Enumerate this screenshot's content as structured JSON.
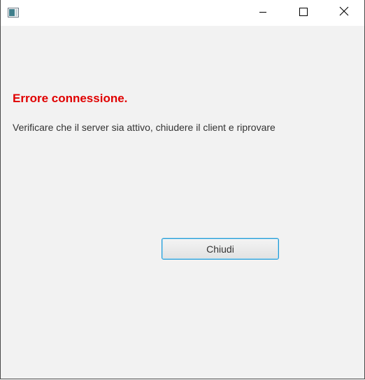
{
  "window": {
    "title_icon": "java-app-icon",
    "controls": {
      "minimize_icon": "minimize-icon",
      "maximize_icon": "maximize-icon",
      "close_icon": "close-icon"
    }
  },
  "dialog": {
    "title": "Errore connessione.",
    "message": "Verificare che il server sia attivo, chiudere il client e riprovare",
    "button_label": "Chiudi"
  },
  "colors": {
    "error_title": "#e00000",
    "background": "#f2f2f2",
    "button_focus_border": "#1e9ad6"
  }
}
